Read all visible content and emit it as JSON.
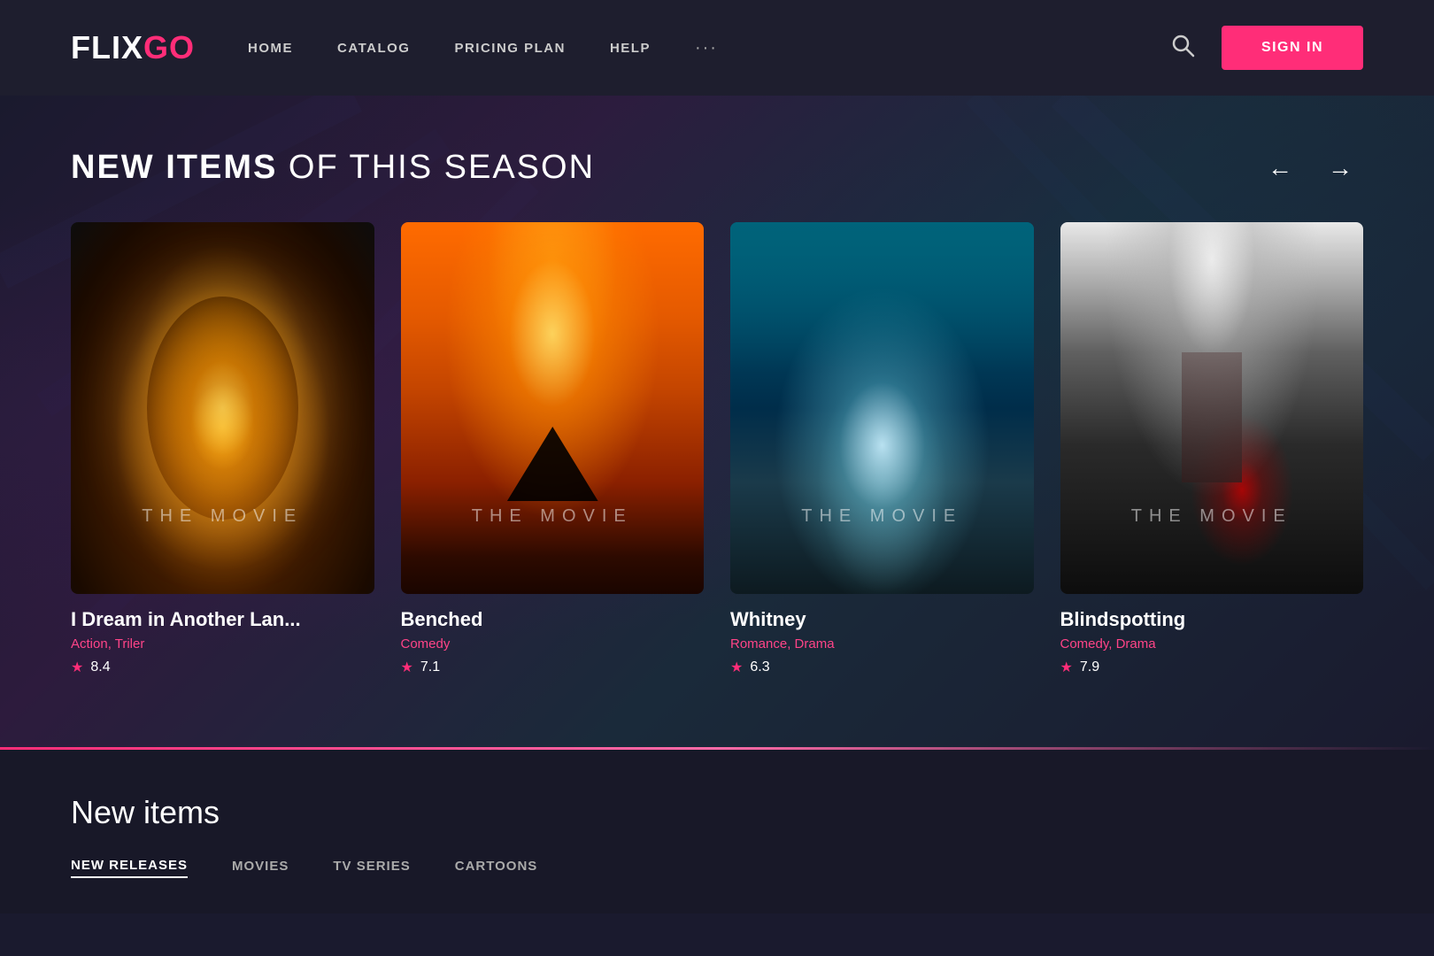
{
  "header": {
    "logo_flix": "FLIX",
    "logo_go": "GO",
    "nav": {
      "home": "HOME",
      "catalog": "CATALOG",
      "pricing": "PRICING PLAN",
      "help": "HELP",
      "more": "···"
    },
    "signin": "SIGN IN"
  },
  "hero": {
    "title_bold": "NEW ITEMS",
    "title_light": " OF THIS SEASON",
    "prev_arrow": "←",
    "next_arrow": "→"
  },
  "movies": [
    {
      "id": 1,
      "title": "I Dream in Another Lan...",
      "genres": "Action, Triler",
      "rating": "8.4",
      "watermark": "THE MOVIE"
    },
    {
      "id": 2,
      "title": "Benched",
      "genres": "Comedy",
      "rating": "7.1",
      "watermark": "THE MOVIE"
    },
    {
      "id": 3,
      "title": "Whitney",
      "genres": "Romance, Drama",
      "rating": "6.3",
      "watermark": "THE MOVIE"
    },
    {
      "id": 4,
      "title": "Blindspotting",
      "genres": "Comedy, Drama",
      "rating": "7.9",
      "watermark": "THE MOVIE"
    }
  ],
  "new_items": {
    "title": "New items",
    "tabs": [
      "NEW RELEASES",
      "MOVIES",
      "TV SERIES",
      "CARTOONS"
    ]
  }
}
